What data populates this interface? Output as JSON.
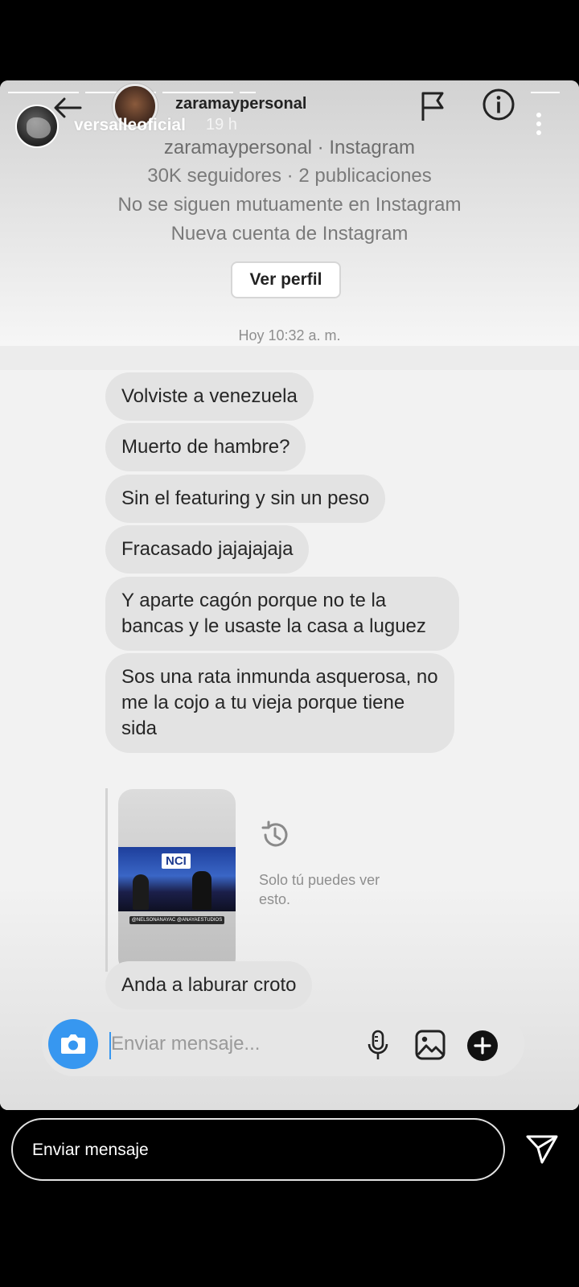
{
  "story": {
    "username": "versalleoficial",
    "time_ago": "19 h"
  },
  "dm": {
    "username": "zaramaypersonal",
    "profile_title": "zaramaypersonal · Instagram",
    "followers_line": "30K seguidores · 2 publicaciones",
    "mutual_line": "No se siguen mutuamente en Instagram",
    "new_account_line": "Nueva cuenta de Instagram",
    "view_profile_label": "Ver perfil",
    "timestamp": "Hoy 10:32 a. m."
  },
  "messages": [
    "Volviste a venezuela",
    "Muerto de hambre?",
    "Sin el featuring y sin un peso",
    "Fracasado jajajajaja",
    "Y aparte cagón porque no te la bancas y le usaste la casa a luguez",
    "Sos una rata inmunda asquerosa, no me la cojo a tu vieja porque tiene sida",
    "Anda a laburar croto"
  ],
  "shared_story": {
    "thumbnail_logo": "NCI",
    "thumbnail_caption": "@NELSONANAYAC @ANAYAESTUDIOS",
    "private_notice": "Solo tú puedes ver esto."
  },
  "composer": {
    "placeholder": "Enviar mensaje..."
  },
  "reply": {
    "label": "Enviar mensaje"
  },
  "icons": {
    "back": "arrow-left-icon",
    "flag": "flag-icon",
    "info": "info-icon",
    "more": "more-vertical-icon",
    "camera": "camera-icon",
    "mic": "microphone-icon",
    "gallery": "image-icon",
    "add": "plus-circle-icon",
    "history": "history-icon",
    "send": "send-icon"
  },
  "colors": {
    "accent": "#3797f0",
    "bubble": "#e3e3e3",
    "muted_text": "#7a7a7a"
  }
}
